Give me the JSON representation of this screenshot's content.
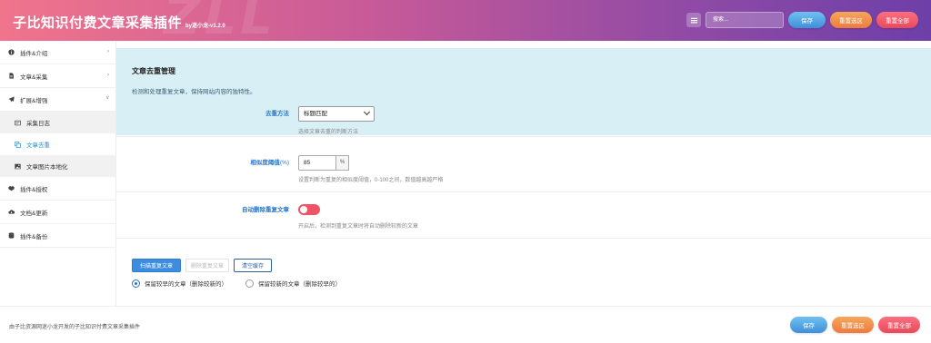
{
  "header": {
    "title": "子比知识付费文章采集插件",
    "version": "by迷小龙-v1.2.0",
    "search_placeholder": "搜索...",
    "save_label": "保存",
    "reset_section_label": "重置选区",
    "reset_all_label": "重置全部",
    "menu_icon": "list-icon"
  },
  "sidebar": {
    "items": [
      {
        "label": "插件&介绍",
        "icon": "info-icon"
      },
      {
        "label": "文章&采集",
        "icon": "document-icon"
      },
      {
        "label": "扩展&增强",
        "icon": "paper-plane-icon"
      },
      {
        "label": "采集日志",
        "icon": "log-icon"
      },
      {
        "label": "文章去重",
        "icon": "copy-icon"
      },
      {
        "label": "文章图片本地化",
        "icon": "image-icon"
      },
      {
        "label": "插件&授权",
        "icon": "handshake-icon"
      },
      {
        "label": "文档&更新",
        "icon": "cloud-download-icon"
      },
      {
        "label": "插件&备份",
        "icon": "database-icon"
      }
    ]
  },
  "section": {
    "title": "文章去重管理",
    "description": "检测和处理重复文章，保持网站内容的独特性。"
  },
  "form": {
    "method": {
      "label": "去重方法",
      "value": "标题匹配",
      "hint": "选择文章去重的判断方法"
    },
    "threshold": {
      "label": "相似度阈值",
      "label_unit": "(%)",
      "value": "85",
      "unit": "%",
      "hint": "设置判断为重复的相似度阈值，0-100之间，数值越高越严格"
    },
    "auto_delete": {
      "label": "自动删除重复文章",
      "on": false,
      "hint": "开启后，检测到重复文章时将自动删除较新的文章"
    }
  },
  "actions": {
    "scan_label": "扫描重复文章",
    "delete_label": "删除重复文章",
    "clear_label": "清空缓存"
  },
  "radios": {
    "keep_old": "保留较早的文章（删除较新的）",
    "keep_new": "保留较新的文章（删除较早的）",
    "selected": "keep_old"
  },
  "footer": {
    "text": "由子比资源网迷小龙开发的子比知识付费文章采集插件",
    "save_label": "保存",
    "reset_section_label": "重置选区",
    "reset_all_label": "重置全部"
  },
  "colors": {
    "accent_blue": "#3c8ce0",
    "toggle_red": "#ee5463",
    "active_link": "#2a8fd6",
    "section_bg": "#d8f0f5"
  }
}
